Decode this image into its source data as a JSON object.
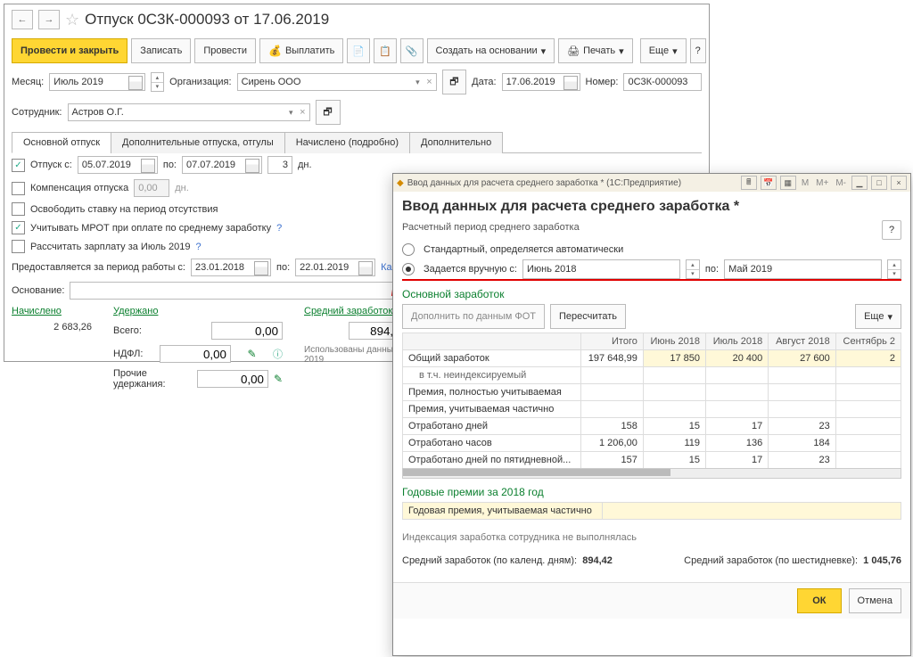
{
  "header": {
    "title": "Отпуск 0С3К-000093 от 17.06.2019"
  },
  "toolbar": {
    "post_close": "Провести и закрыть",
    "save": "Записать",
    "post": "Провести",
    "pay": "Выплатить",
    "create_based": "Создать на основании",
    "print": "Печать",
    "more": "Еще"
  },
  "fields": {
    "month_lbl": "Месяц:",
    "month_val": "Июль 2019",
    "org_lbl": "Организация:",
    "org_val": "Сирень ООО",
    "date_lbl": "Дата:",
    "date_val": "17.06.2019",
    "number_lbl": "Номер:",
    "number_val": "0С3К-000093",
    "employee_lbl": "Сотрудник:",
    "employee_val": "Астров О.Г."
  },
  "tabs": {
    "main": "Основной отпуск",
    "extra": "Дополнительные отпуска, отгулы",
    "accrued": "Начислено (подробно)",
    "additional": "Дополнительно"
  },
  "vacation": {
    "vac_lbl": "Отпуск  с:",
    "from": "05.07.2019",
    "to_lbl": "по:",
    "to": "07.07.2019",
    "days": "3",
    "days_lbl": "дн.",
    "comp_lbl": "Компенсация отпуска",
    "comp_val": "0,00",
    "comp_unit": "дн.",
    "release_lbl": "Освободить ставку на период отсутствия",
    "mrot_lbl": "Учитывать МРОТ при оплате по среднему заработку",
    "calc_salary_lbl": "Рассчитать зарплату за Июль 2019",
    "period_lbl": "Предоставляется за период работы с:",
    "period_from": "23.01.2018",
    "period_to_lbl": "по:",
    "period_to": "22.01.2019",
    "how_link": "Как",
    "basis_lbl": "Основание:"
  },
  "totals": {
    "accrued_hdr": "Начислено",
    "accrued_val": "2 683,26",
    "withheld_hdr": "Удержано",
    "total_lbl": "Всего:",
    "total_val": "0,00",
    "ndfl_lbl": "НДФЛ:",
    "ndfl_val": "0,00",
    "other_lbl": "Прочие удержания:",
    "other_val": "0,00",
    "avg_hdr": "Средний заработок",
    "avg_val": "894,42",
    "note1": "Использованы данны",
    "note2": "2019"
  },
  "modal": {
    "win_title": "Ввод данных для расчета среднего заработка *  (1С:Предприятие)",
    "title": "Ввод данных для расчета среднего заработка *",
    "period_section": "Расчетный период среднего заработка",
    "radio_auto": "Стандартный, определяется автоматически",
    "radio_manual": "Задается вручную   с:",
    "period_from": "Июнь 2018",
    "period_to_lbl": "по:",
    "period_to": "Май 2019",
    "main_earnings": "Основной заработок",
    "fill_fot": "Дополнить по данным ФОТ",
    "recalc": "Пересчитать",
    "more": "Еще",
    "table": {
      "cols": [
        "",
        "Итого",
        "Июнь 2018",
        "Июль 2018",
        "Август 2018",
        "Сентябрь 2"
      ],
      "rows": [
        {
          "label": "Общий заработок",
          "vals": [
            "197 648,99",
            "17 850",
            "20 400",
            "27 600",
            "2"
          ],
          "hl": true
        },
        {
          "label": "в т.ч. неиндексируемый",
          "vals": [
            "",
            "",
            "",
            "",
            ""
          ],
          "indent": true
        },
        {
          "label": "Премия, полностью учитываемая",
          "vals": [
            "",
            "",
            "",
            "",
            ""
          ]
        },
        {
          "label": "Премия, учитываемая частично",
          "vals": [
            "",
            "",
            "",
            "",
            ""
          ]
        },
        {
          "label": "Отработано дней",
          "vals": [
            "158",
            "15",
            "17",
            "23",
            ""
          ]
        },
        {
          "label": "Отработано часов",
          "vals": [
            "1 206,00",
            "119",
            "136",
            "184",
            ""
          ]
        },
        {
          "label": "Отработано дней по пятидневной...",
          "vals": [
            "157",
            "15",
            "17",
            "23",
            ""
          ]
        }
      ]
    },
    "annual_bonus": "Годовые премии за 2018 год",
    "annual_bonus_row": "Годовая премия, учитываемая частично",
    "index_note": "Индексация заработка сотрудника не выполнялась",
    "avg_cal_lbl": "Средний заработок (по календ. дням):",
    "avg_cal_val": "894,42",
    "avg_six_lbl": "Средний заработок (по шестидневке):",
    "avg_six_val": "1 045,76",
    "ok": "ОК",
    "cancel": "Отмена",
    "marks": [
      "M",
      "M+",
      "M-"
    ]
  }
}
